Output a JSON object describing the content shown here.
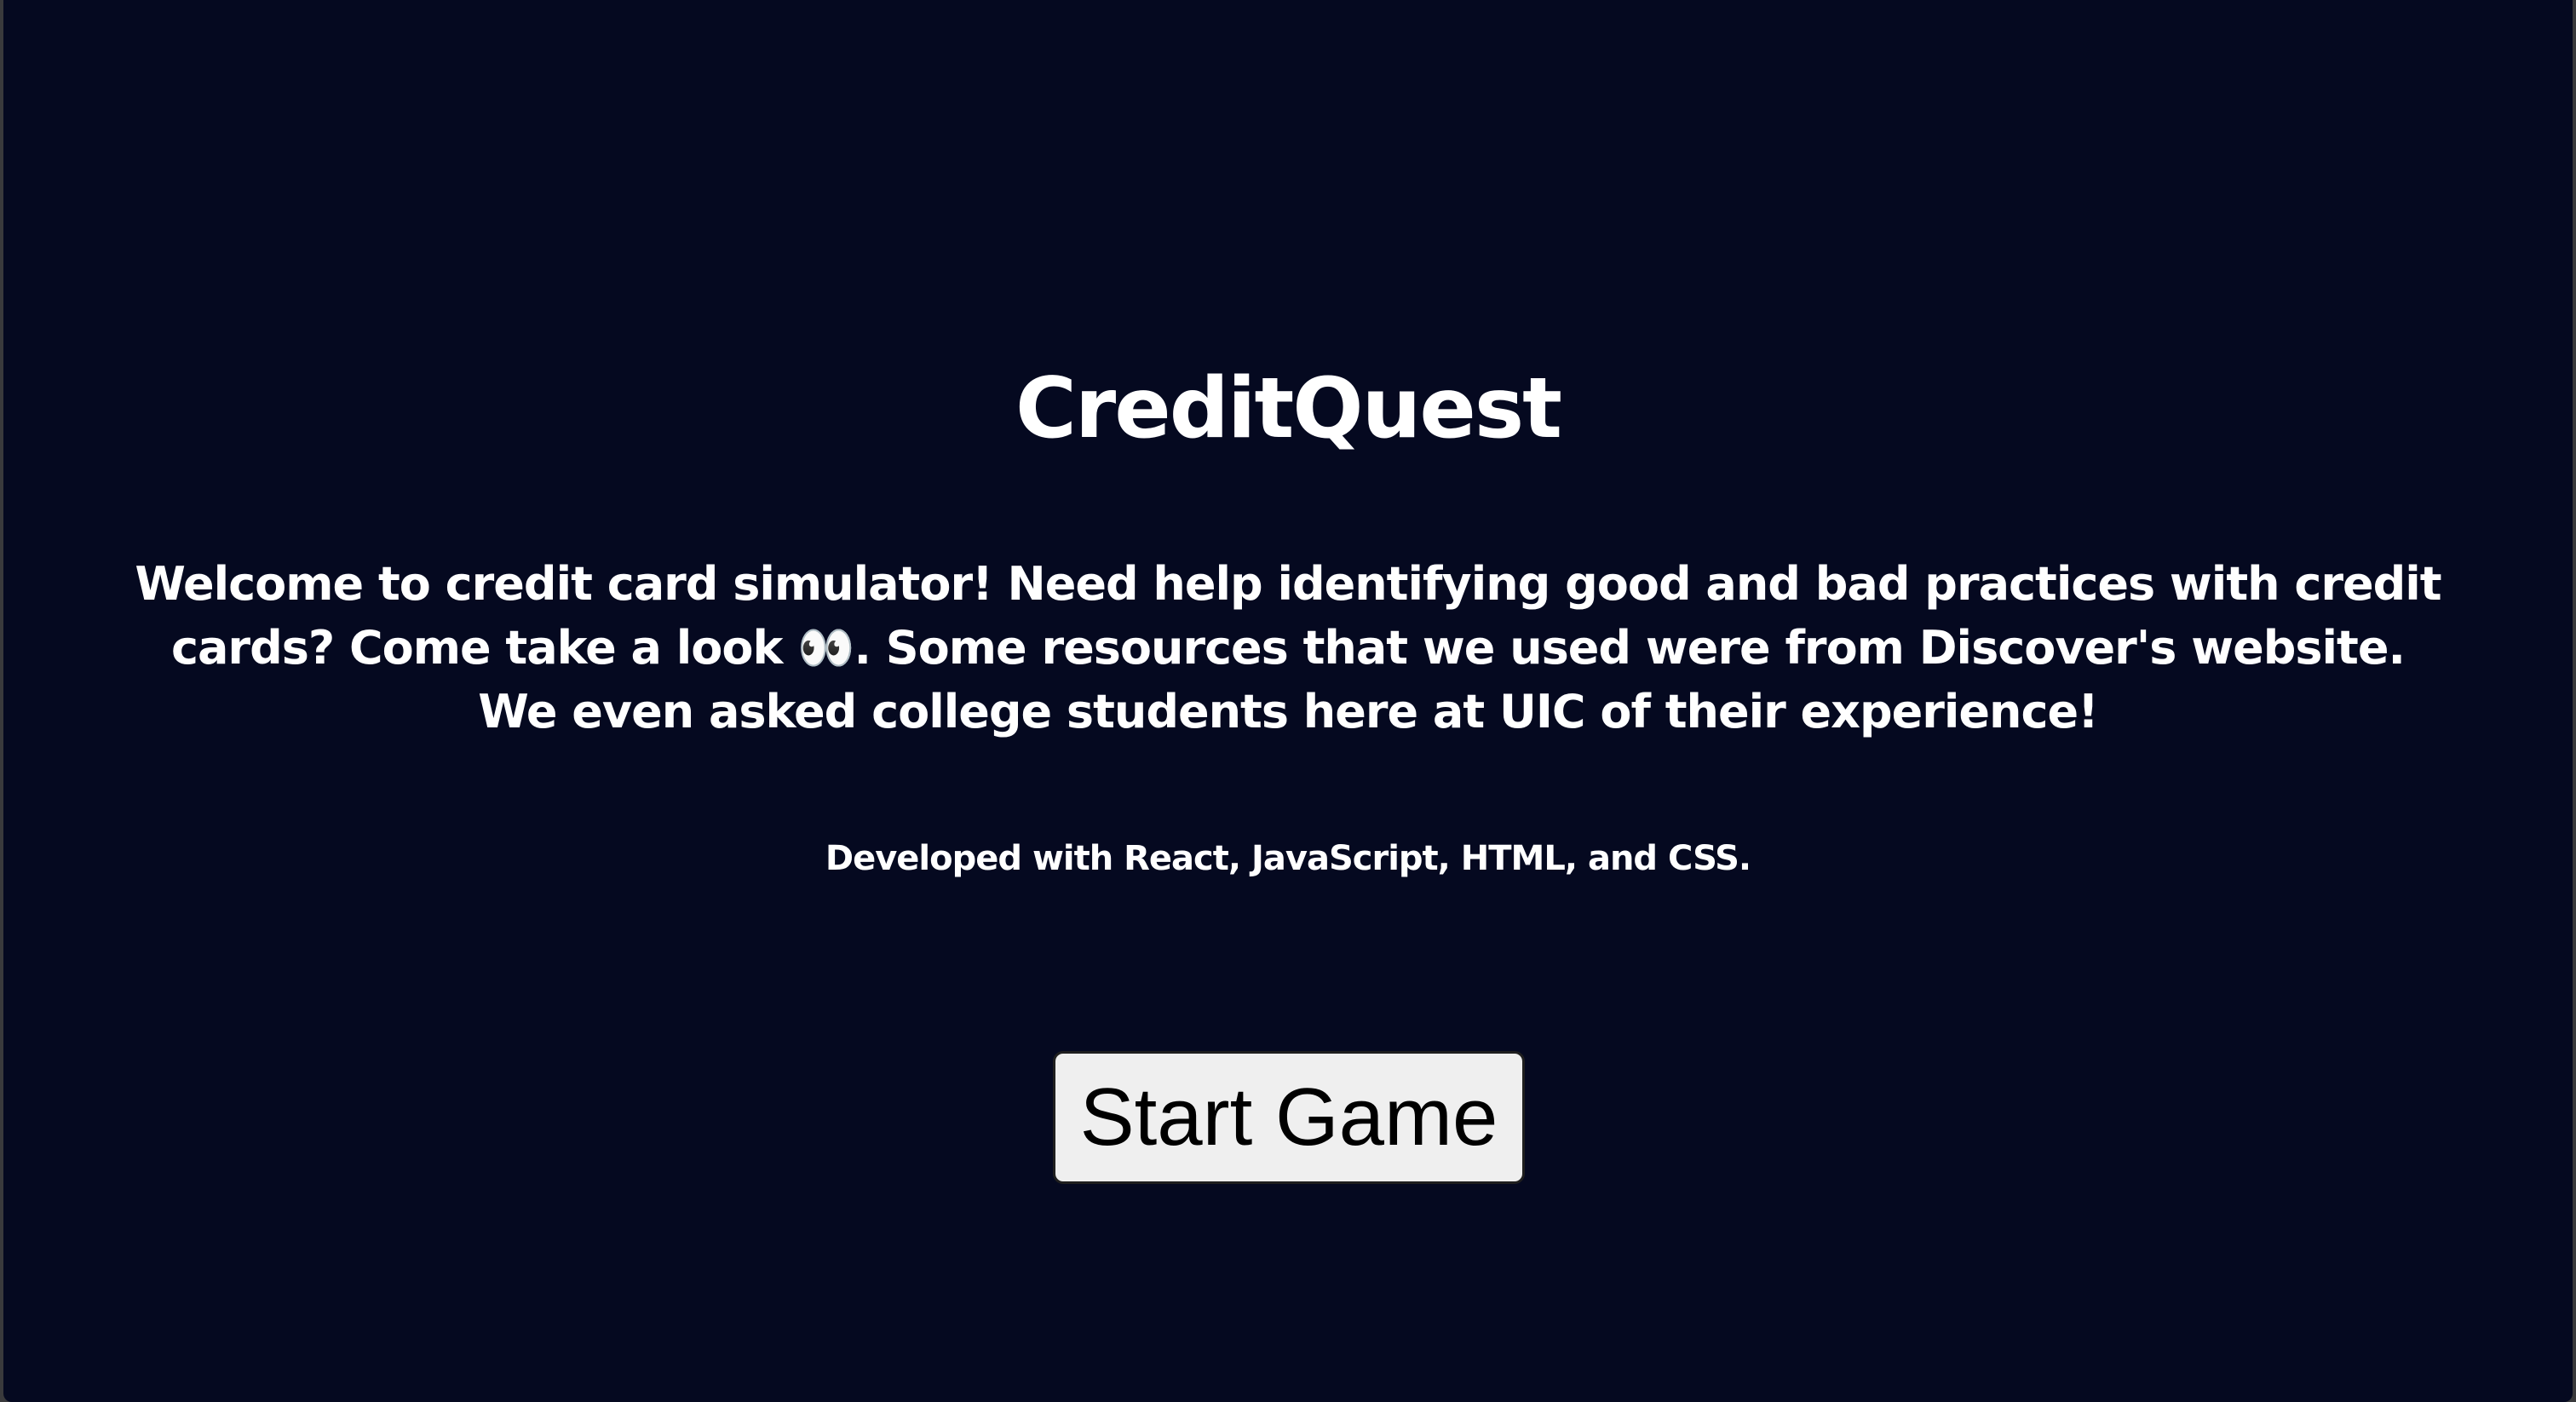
{
  "app": {
    "title": "CreditQuest"
  },
  "intro": {
    "text_before_icon": "Welcome to credit card simulator! Need help identifying good and bad practices with credit cards? Come take a look ",
    "eyes_icon": "👀",
    "text_after_icon": ". Some resources that we used were from Discover's website. We even asked college students here at UIC of their experience!"
  },
  "tech_note": "Developed with React, JavaScript, HTML, and CSS.",
  "start_button": {
    "label": "Start Game"
  },
  "colors": {
    "background": "#050920",
    "text": "#ffffff",
    "button_background": "#efefef",
    "button_text": "#000000"
  }
}
